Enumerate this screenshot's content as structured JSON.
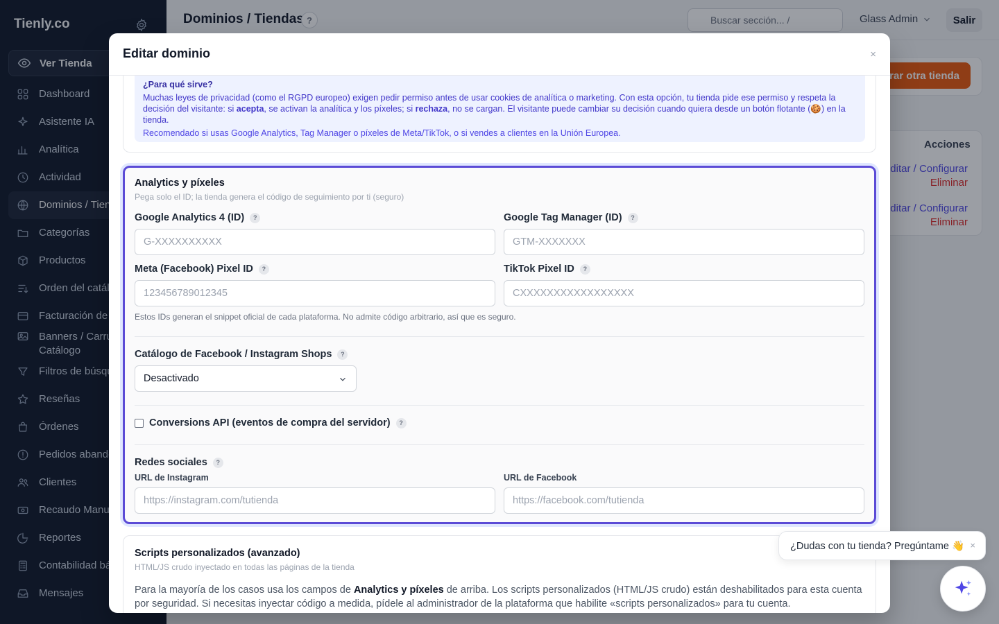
{
  "app": {
    "brand": "Tienly.co",
    "ver_tienda": "Ver Tienda"
  },
  "sidebar": {
    "items": [
      {
        "label": "Dashboard",
        "icon": "grid-icon"
      },
      {
        "label": "Asistente IA",
        "icon": "sparkle-icon"
      },
      {
        "label": "Analítica",
        "icon": "bar-chart-icon"
      },
      {
        "label": "Actividad",
        "icon": "clock-icon"
      },
      {
        "label": "Dominios / Tien",
        "icon": "globe-icon",
        "active": true
      },
      {
        "label": "Categorías",
        "icon": "folder-icon"
      },
      {
        "label": "Productos",
        "icon": "box-icon"
      },
      {
        "label": "Orden del catál",
        "icon": "sort-icon"
      },
      {
        "label": "Facturación de",
        "icon": "card-icon"
      },
      {
        "label": "Banners / Carru\nCatálogo",
        "icon": "image-icon"
      },
      {
        "label": "Filtros de búsqu",
        "icon": "filter-icon"
      },
      {
        "label": "Reseñas",
        "icon": "star-icon"
      },
      {
        "label": "Órdenes",
        "icon": "bag-icon"
      },
      {
        "label": "Pedidos abando",
        "icon": "alert-icon"
      },
      {
        "label": "Clientes",
        "icon": "users-icon"
      },
      {
        "label": "Recaudo Manua",
        "icon": "cash-icon"
      },
      {
        "label": "Reportes",
        "icon": "pie-icon"
      },
      {
        "label": "Contabilidad bá",
        "icon": "calculator-icon"
      },
      {
        "label": "Mensajes",
        "icon": "inbox-icon"
      }
    ]
  },
  "header": {
    "title": "Dominios / Tiendas",
    "help": "?",
    "search_placeholder": "Buscar sección...  /",
    "admin": "Glass Admin",
    "logout": "Salir"
  },
  "background": {
    "orange_button": "rar otra tienda",
    "acciones": "Acciones",
    "rows": [
      {
        "edit": "Editar / Configurar",
        "delete": "Eliminar"
      },
      {
        "edit": "Editar / Configurar",
        "delete": "Eliminar"
      }
    ]
  },
  "modal": {
    "title": "Editar dominio",
    "close": "×",
    "consent": {
      "question": "¿Para qué sirve?",
      "para_a": "Muchas leyes de privacidad (como el RGPD europeo) exigen pedir permiso antes de usar cookies de analítica o marketing. Con esta opción, tu tienda pide ese permiso y respeta la decisión del visitante: si ",
      "acepta": "acepta",
      "para_b": ", se activan la analítica y los píxeles; si ",
      "rechaza": "rechaza",
      "para_c": ", no se cargan. El visitante puede cambiar su decisión cuando quiera desde un botón flotante (🍪) en la tienda.",
      "recommend": "Recomendado si usas Google Analytics, Tag Manager o píxeles de Meta/TikTok, o si vendes a clientes en la Unión Europea."
    },
    "analytics": {
      "title": "Analytics y píxeles",
      "subtitle": "Pega solo el ID; la tienda genera el código de seguimiento por ti (seguro)",
      "ga4_label": "Google Analytics 4 (ID)",
      "ga4_placeholder": "G-XXXXXXXXXX",
      "gtm_label": "Google Tag Manager (ID)",
      "gtm_placeholder": "GTM-XXXXXXX",
      "meta_label": "Meta (Facebook) Pixel ID",
      "meta_placeholder": "123456789012345",
      "tiktok_label": "TikTok Pixel ID",
      "tiktok_placeholder": "CXXXXXXXXXXXXXXXXX",
      "hint": "Estos IDs generan el snippet oficial de cada plataforma. No admite código arbitrario, así que es seguro.",
      "catalog_label": "Catálogo de Facebook / Instagram Shops",
      "catalog_value": "Desactivado",
      "capi_label": "Conversions API (eventos de compra del servidor)",
      "capi_checked": false,
      "social_label": "Redes sociales",
      "instagram_label": "URL de Instagram",
      "instagram_placeholder": "https://instagram.com/tutienda",
      "facebook_label": "URL de Facebook",
      "facebook_placeholder": "https://facebook.com/tutienda",
      "help": "?"
    },
    "scripts": {
      "title": "Scripts personalizados (avanzado)",
      "subtitle": "HTML/JS crudo inyectado en todas las páginas de la tienda",
      "text_a": "Para la mayoría de los casos usa los campos de ",
      "text_bold": "Analytics y píxeles",
      "text_b": " de arriba. Los scripts personalizados (HTML/JS crudo) están deshabilitados para esta cuenta por seguridad. Si necesitas inyectar código a medida, pídele al administrador de la plataforma que habilite «scripts personalizados» para tu cuenta."
    }
  },
  "chat": {
    "bubble": "¿Dudas con tu tienda? Pregúntame 👋",
    "close": "×"
  },
  "colors": {
    "sidebar_bg": "#0f1729",
    "accent": "#5b4bd6",
    "orange": "#ea580c",
    "danger": "#dc2626",
    "link": "#4f46e5"
  }
}
